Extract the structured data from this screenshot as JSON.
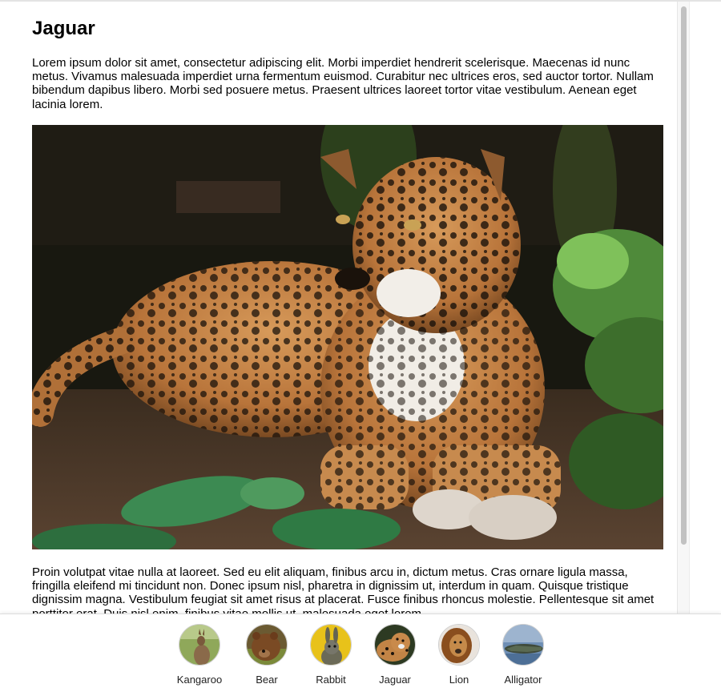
{
  "article": {
    "title": "Jaguar",
    "intro": "Lorem ipsum dolor sit amet, consectetur adipiscing elit. Morbi imperdiet hendrerit scelerisque. Maecenas id nunc metus. Vivamus malesuada imperdiet urna fermentum euismod. Curabitur nec ultrices eros, sed auctor tortor. Nullam bibendum dapibus libero. Morbi sed posuere metus. Praesent ultrices laoreet tortor vitae vestibulum. Aenean eget lacinia lorem.",
    "body": "Proin volutpat vitae nulla at laoreet. Sed eu elit aliquam, finibus arcu in, dictum metus. Cras ornare ligula massa, fringilla eleifend mi tincidunt non. Donec ipsum nisl, pharetra in dignissim ut, interdum in quam. Quisque tristique dignissim magna. Vestibulum feugiat sit amet risus at placerat. Fusce finibus rhoncus molestie. Pellentesque sit amet porttitor erat. Duis nisl enim, finibus vitae mollis ut, malesuada eget lorem."
  },
  "nav": {
    "items": [
      {
        "label": "Kangaroo",
        "icon": "kangaroo-photo"
      },
      {
        "label": "Bear",
        "icon": "bear-photo"
      },
      {
        "label": "Rabbit",
        "icon": "rabbit-photo"
      },
      {
        "label": "Jaguar",
        "icon": "jaguar-photo"
      },
      {
        "label": "Lion",
        "icon": "lion-photo"
      },
      {
        "label": "Alligator",
        "icon": "alligator-photo"
      }
    ]
  }
}
